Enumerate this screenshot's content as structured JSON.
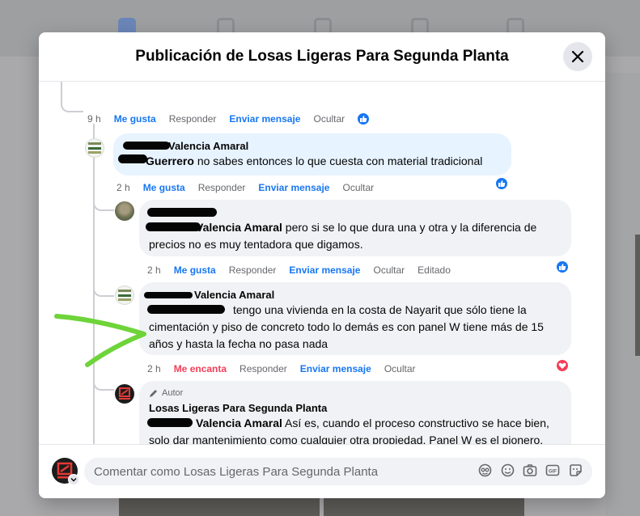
{
  "modal": {
    "title": "Publicación de Losas Ligeras Para Segunda Planta",
    "close_label": "×"
  },
  "top_actions": {
    "time": "9 h",
    "like": "Me gusta",
    "reply": "Responder",
    "send_message": "Enviar mensaje",
    "hide": "Ocultar"
  },
  "comments": [
    {
      "author_suffix": "Valencia Amaral",
      "mention": "Guerrero",
      "text": "no sabes entonces lo que cuesta con material tradicional",
      "actions": {
        "time": "2 h",
        "like": "Me gusta",
        "reply": "Responder",
        "send_message": "Enviar mensaje",
        "hide": "Ocultar"
      },
      "reaction": "like"
    },
    {
      "mention": "Valencia Amaral",
      "text": "pero si se lo que dura una y otra y la diferencia de precios no es muy tentadora que digamos.",
      "actions": {
        "time": "2 h",
        "like": "Me gusta",
        "reply": "Responder",
        "send_message": "Enviar mensaje",
        "hide": "Ocultar",
        "edited": "Editado"
      },
      "reaction": "like"
    },
    {
      "author_suffix": "Valencia Amaral",
      "text_line1": "tengo una vivienda en la costa de Nayarit que sólo tiene la",
      "text_rest": "cimentación y piso de concreto todo lo demás es con panel W tiene más de 15 años y hasta la fecha no pasa nada",
      "actions": {
        "time": "2 h",
        "like": "Me encanta",
        "reply": "Responder",
        "send_message": "Enviar mensaje",
        "hide": "Ocultar"
      },
      "reaction": "heart"
    },
    {
      "badge": "Autor",
      "author": "Losas Ligeras Para Segunda Planta",
      "mention": "Valencia Amaral",
      "text": "Así es, cuando el proceso constructivo se hace bien, solo dar mantenimiento como cualquier otra propiedad. Panel W es el pionero, aunque existen otros fabricantes en el país. Solo que muchos lo desconocen el sistema o solo lo asocian con muros tapon, divisorios. Gracias"
    }
  ],
  "composer": {
    "placeholder": "Comentar como Losas Ligeras Para Segunda Planta",
    "icons": [
      "avatar-sticker-icon",
      "emoji-icon",
      "camera-icon",
      "gif-icon",
      "sticker-icon"
    ]
  },
  "colors": {
    "link": "#1877f2",
    "love": "#f33e58",
    "bubble": "#f0f2f5",
    "highlight": "#e7f3ff",
    "annotation": "#6ed43a"
  }
}
